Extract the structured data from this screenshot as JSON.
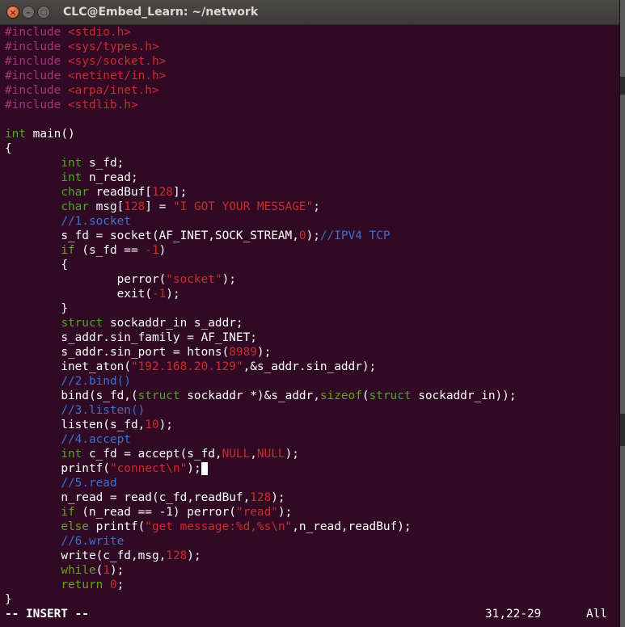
{
  "window": {
    "title": "CLC@Embed_Learn: ~/network"
  },
  "code": {
    "l1": {
      "a": "#include ",
      "b": "<stdio.h>"
    },
    "l2": {
      "a": "#include ",
      "b": "<sys/types.h>"
    },
    "l3": {
      "a": "#include ",
      "b": "<sys/socket.h>"
    },
    "l4": {
      "a": "#include ",
      "b": "<netinet/in.h>"
    },
    "l5": {
      "a": "#include ",
      "b": "<arpa/inet.h>"
    },
    "l6": {
      "a": "#include ",
      "b": "<stdlib.h>"
    },
    "l8": {
      "a": "int",
      "b": " main()"
    },
    "l9": {
      "a": "{"
    },
    "l10": {
      "i": "        ",
      "a": "int",
      "b": " s_fd;"
    },
    "l11": {
      "i": "        ",
      "a": "int",
      "b": " n_read;"
    },
    "l12": {
      "i": "        ",
      "a": "char",
      "b": " readBuf[",
      "c": "128",
      "d": "];"
    },
    "l13": {
      "i": "        ",
      "a": "char",
      "b": " msg[",
      "c": "128",
      "d": "] = ",
      "e": "\"I GOT YOUR MESSAGE\"",
      "f": ";"
    },
    "l14": {
      "i": "        ",
      "a": "//1.socket"
    },
    "l15": {
      "i": "        ",
      "a": "s_fd = socket(AF_INET,SOCK_STREAM,",
      "b": "0",
      "c": ");",
      "d": "//IPV4 TCP"
    },
    "l16": {
      "i": "        ",
      "a": "if",
      "b": " (s_fd == ",
      "c": "-1",
      "d": ")"
    },
    "l17": {
      "i": "        ",
      "a": "{"
    },
    "l18": {
      "i": "                ",
      "a": "perror(",
      "b": "\"socket\"",
      "c": ");"
    },
    "l19": {
      "i": "                ",
      "a": "exit(",
      "b": "-1",
      "c": ");"
    },
    "l20": {
      "i": "        ",
      "a": "}"
    },
    "l21": {
      "i": "        ",
      "a": "struct",
      "b": " sockaddr_in s_addr;"
    },
    "l22": {
      "i": "        ",
      "a": "s_addr.sin_family = AF_INET;"
    },
    "l23": {
      "i": "        ",
      "a": "s_addr.sin_port = htons(",
      "b": "8989",
      "c": ");"
    },
    "l24": {
      "i": "        ",
      "a": "inet_aton(",
      "b": "\"192.168.20.129\"",
      "c": ",&s_addr.sin_addr);"
    },
    "l25": {
      "i": "        ",
      "a": "//2.bind()"
    },
    "l26": {
      "i": "        ",
      "a": "bind(s_fd,(",
      "b": "struct",
      "c": " sockaddr *)&s_addr,",
      "d": "sizeof",
      "e": "(",
      "f": "struct",
      "g": " sockaddr_in));"
    },
    "l27": {
      "i": "        ",
      "a": "//3.listen()"
    },
    "l28": {
      "i": "        ",
      "a": "listen(s_fd,",
      "b": "10",
      "c": ");"
    },
    "l29": {
      "i": "        ",
      "a": "//4.accept"
    },
    "l30": {
      "i": "        ",
      "a": "int",
      "b": " c_fd = accept(s_fd,",
      "c": "NULL",
      "d": ",",
      "e": "NULL",
      "f": ");"
    },
    "l31": {
      "i": "        ",
      "a": "printf(",
      "b": "\"connect\\n\"",
      "c": ");"
    },
    "l32": {
      "i": "        ",
      "a": "//5.read"
    },
    "l33": {
      "i": "        ",
      "a": "n_read = read(c_fd,readBuf,",
      "b": "128",
      "c": ");"
    },
    "l34": {
      "i": "        ",
      "a": "if",
      "b": " (n_read == -1) perror(",
      "c": "\"read\"",
      "d": ");"
    },
    "l35": {
      "i": "        ",
      "a": "else",
      "b": " printf(",
      "c": "\"get message:%d,%s\\n\"",
      "d": ",n_read,readBuf);"
    },
    "l36": {
      "i": "        ",
      "a": "//6.write"
    },
    "l37": {
      "i": "        ",
      "a": "write(c_fd,msg,",
      "b": "128",
      "c": ");"
    },
    "l38": {
      "i": "        ",
      "a": "while",
      "b": "(",
      "c": "1",
      "d": ");"
    },
    "l39": {
      "i": "        ",
      "a": "return",
      "b": " ",
      "c": "0",
      "d": ";"
    },
    "l40": {
      "a": "}"
    }
  },
  "status": {
    "mode": "-- INSERT --",
    "position": "31,22-29",
    "scroll": "All"
  },
  "colors": {
    "background": "#300a24",
    "preprocessor": "#a5357f",
    "string": "#cc2c2c",
    "type_keyword": "#6aa121",
    "comment": "#3a72d4",
    "text": "#ffffff"
  }
}
